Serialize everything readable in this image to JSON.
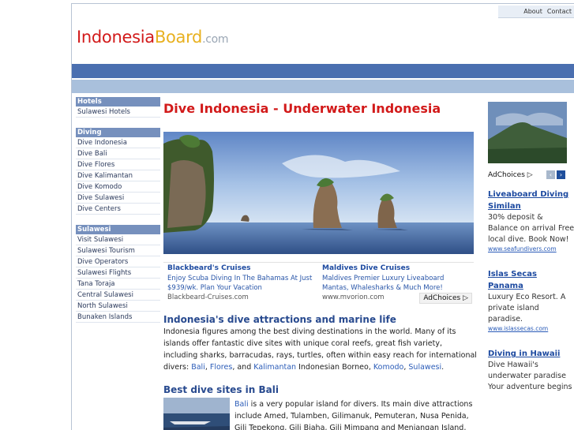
{
  "header": {
    "links": [
      "About",
      "Contact"
    ],
    "logo": {
      "part1": "Indonesia",
      "part2": "Board",
      "part3": ".com"
    }
  },
  "sidebar": {
    "sections": [
      {
        "heading": "Hotels",
        "items": [
          "Sulawesi Hotels"
        ]
      },
      {
        "heading": "Diving",
        "items": [
          "Dive Indonesia",
          "Dive Bali",
          "Dive Flores",
          "Dive Kalimantan",
          "Dive Komodo",
          "Dive Sulawesi",
          "Dive Centers"
        ]
      },
      {
        "heading": "Sulawesi",
        "items": [
          "Visit Sulawesi",
          "Sulawesi Tourism",
          "Dive Operators",
          "Sulawesi Flights",
          "Tana Toraja",
          "Central Sulawesi",
          "North Sulawesi",
          "Bunaken Islands"
        ]
      }
    ]
  },
  "main": {
    "title": "Dive Indonesia - Underwater Indonesia",
    "ads": [
      {
        "title": "Blackbeard's Cruises",
        "desc": "Enjoy Scuba Diving In The Bahamas At Just $939/wk. Plan Your Vacation",
        "url": "Blackbeard-Cruises.com"
      },
      {
        "title": "Maldives Dive Cruises",
        "desc": "Maldives Premier Luxury Liveaboard Mantas, Whalesharks & Much More!",
        "url": "www.mvorion.com"
      }
    ],
    "adchoices": "AdChoices",
    "section1": {
      "heading": "Indonesia's dive attractions and marine life",
      "text_a": "Indonesia figures among the best diving destinations in the world. Many of its islands offer fantastic dive sites with unique coral reefs, great fish variety, including sharks, barracudas, rays, turtles, often within easy reach for international divers: ",
      "link_bali": "Bali",
      "sep1": ", ",
      "link_flores": "Flores",
      "sep2": ", and ",
      "link_kalimantan": "Kalimantan",
      "text_b": " Indonesian Borneo, ",
      "link_komodo": "Komodo",
      "sep3": ", ",
      "link_sulawesi": "Sulawesi",
      "end": "."
    },
    "section2": {
      "heading": "Best dive sites in Bali",
      "link_bali": "Bali",
      "text": " is a very popular island for divers. Its main dive attractions include Amed, Tulamben, Gilimanuk, Pemuteran, Nusa Penida, Gili Tepekong, Gili Biaha, Gili Mimpang and Menjangan Island, which offer good coral and fish variety."
    }
  },
  "right": {
    "adchoices": "AdChoices",
    "ads": [
      {
        "title": "Liveaboard Diving Similan",
        "desc": "30% deposit & Balance on arrival Free local dive. Book Now!",
        "url": "www.seafundivers.com"
      },
      {
        "title": "Islas Secas Panama",
        "desc": "Luxury Eco Resort. A private island paradise.",
        "url": "www.islassecas.com"
      },
      {
        "title": "Diving in Hawaii",
        "desc": "Dive Hawaii's underwater paradise Your adventure begins",
        "url": ""
      }
    ]
  },
  "colors": {
    "accent": "#d21a1a",
    "logo_gold": "#e8b120",
    "nav_bar": "#4a6fb0",
    "link": "#2b5cb8"
  }
}
